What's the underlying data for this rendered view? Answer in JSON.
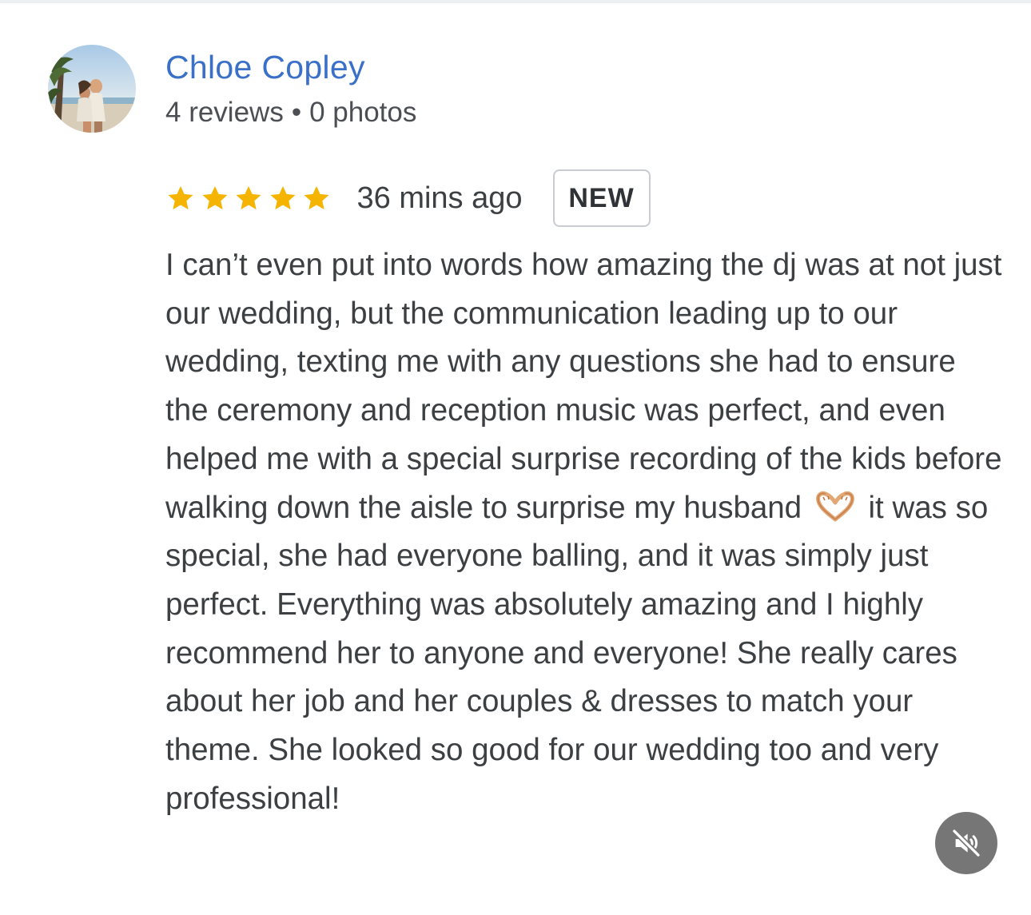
{
  "reviewer": {
    "name": "Chloe Copley",
    "reviews": "4 reviews",
    "separator": "•",
    "photos": "0 photos"
  },
  "rating": {
    "stars": 5,
    "out_of": 5,
    "star_color": "#f4b400"
  },
  "review": {
    "time_ago": "36 mins ago",
    "badge": "NEW",
    "text_part1": "I can’t even put into words how amazing the dj was at not just our wedding, but the communication leading up to our wedding, texting me with any questions she had to ensure the ceremony and reception music was perfect, and even helped me with a special surprise recording of the kids before walking down the aisle to surprise my husband",
    "emoji": "heart-hands-emoji",
    "text_part2": "it was so special, she had everyone balling, and it was simply just perfect. Everything was absolutely amazing and I highly recommend her to anyone and everyone! She really cares about her job and her couples & dresses to match your theme. She looked so good for our wedding too and very professional!"
  },
  "controls": {
    "mute_icon": "speaker-muted-icon"
  },
  "colors": {
    "name": "#3a70c8",
    "text": "#3c4043",
    "meta": "#4b4f54",
    "mute_button_bg": "#767676"
  }
}
